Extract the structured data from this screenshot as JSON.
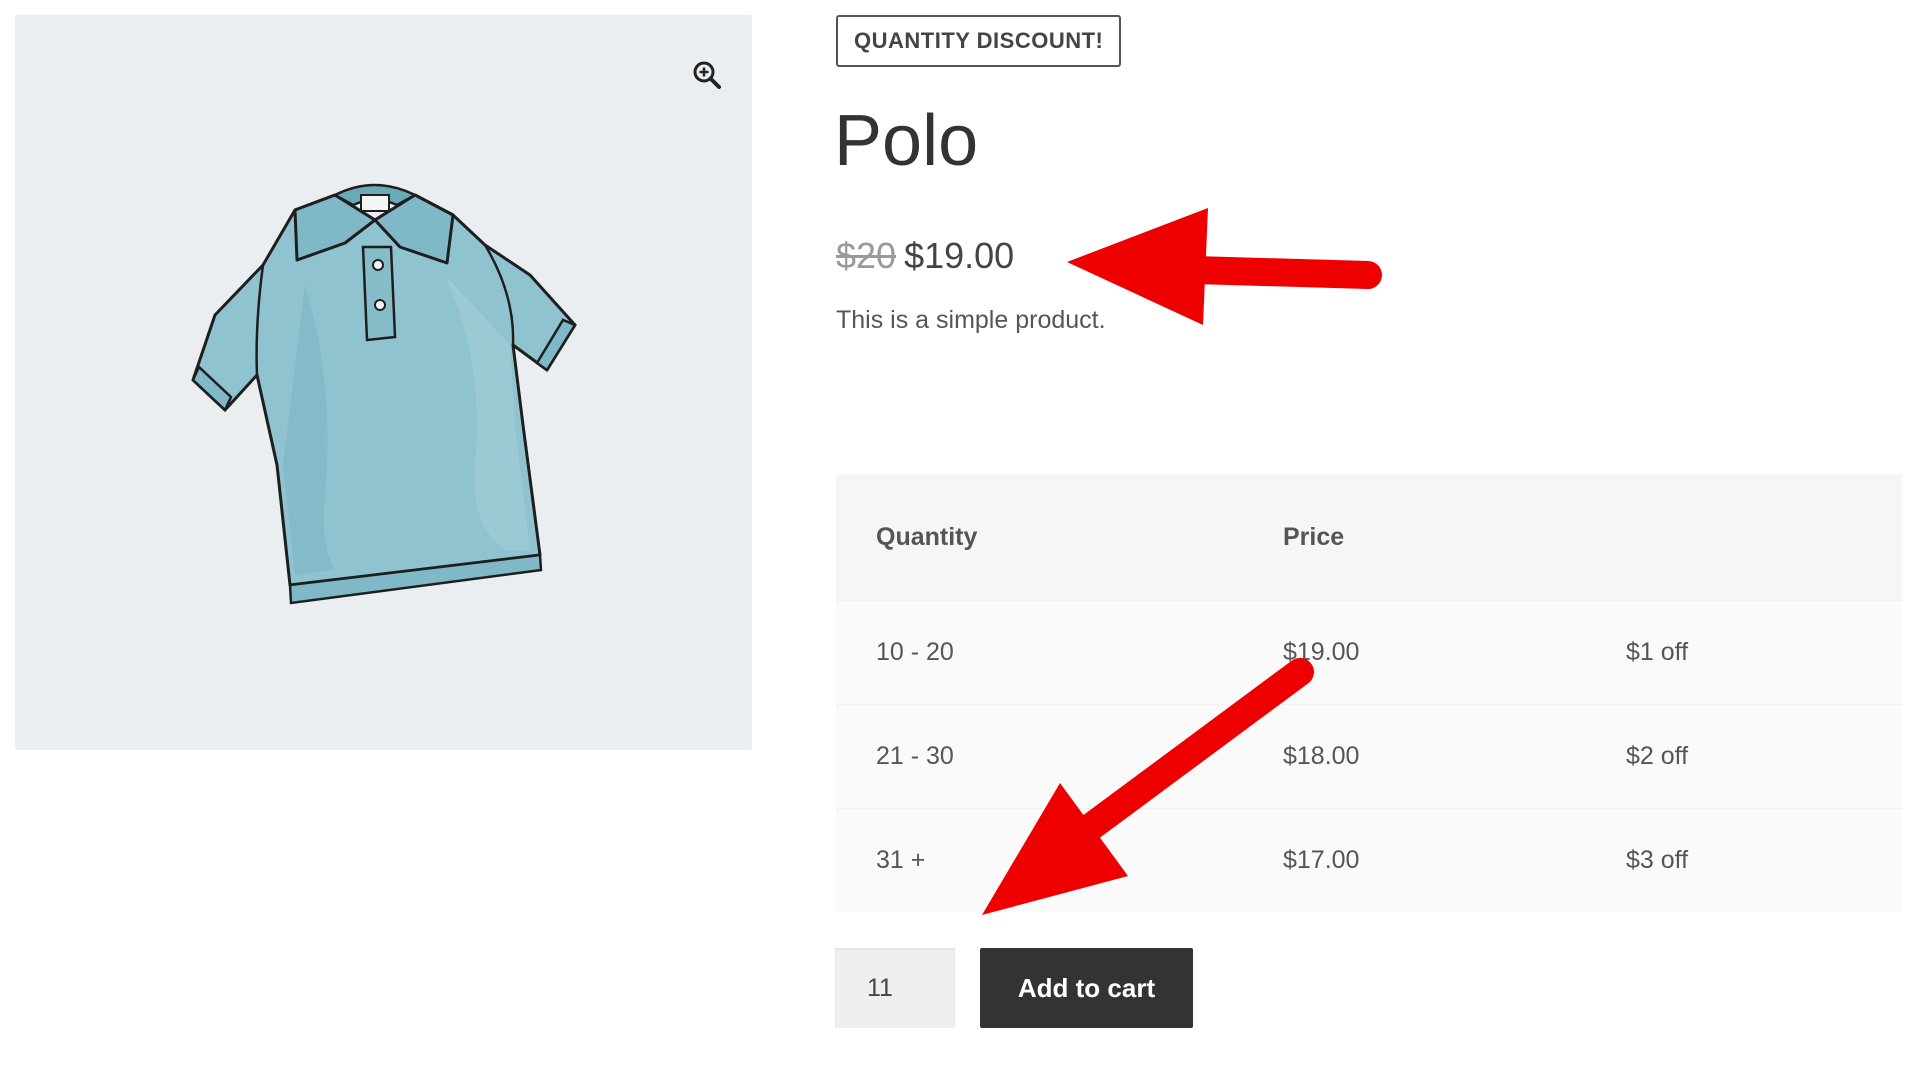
{
  "gallery": {
    "zoom_icon": "zoom-in-icon",
    "image": "polo-shirt-illustration"
  },
  "product": {
    "badge": "QUANTITY DISCOUNT!",
    "title": "Polo",
    "price_regular": "$20",
    "price_sale": "$19.00",
    "short_description": "This is a simple product."
  },
  "pricing_table": {
    "headers": [
      "Quantity",
      "Price",
      ""
    ],
    "rows": [
      {
        "quantity": "10 - 20",
        "price": "$19.00",
        "discount": "$1 off"
      },
      {
        "quantity": "21 - 30",
        "price": "$18.00",
        "discount": "$2 off"
      },
      {
        "quantity": "31 +",
        "price": "$17.00",
        "discount": "$3 off"
      }
    ]
  },
  "cart": {
    "quantity_value": "11",
    "add_to_cart_label": "Add to cart"
  },
  "annotations": {
    "arrow_color": "#ee0000"
  },
  "colors": {
    "gallery_bg": "#eaeef1",
    "shirt_fill": "#8fc3cf",
    "button_bg": "#333333"
  }
}
